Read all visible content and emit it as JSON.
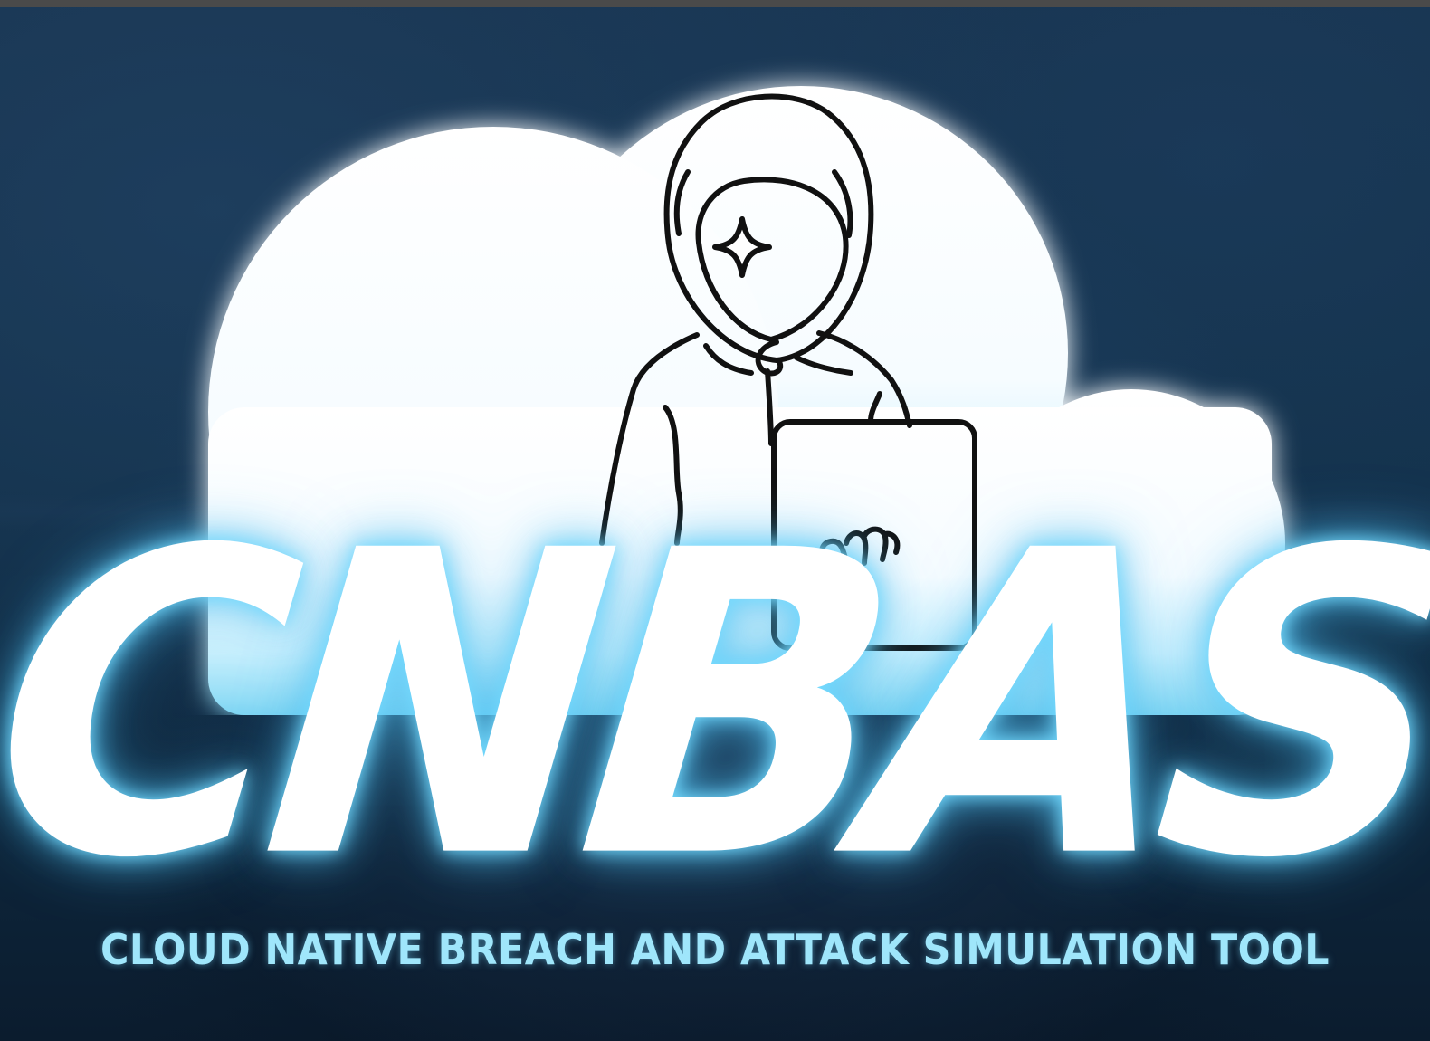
{
  "logo": {
    "wordmark": "CNBAS",
    "tagline": "CLOUD NATIVE BREACH AND ATTACK SIMULATION TOOL",
    "figure_icon": "hooded-hacker-with-laptop-icon"
  },
  "colors": {
    "background": "#123049",
    "cloud": "#ffffff",
    "glow": "#7fdcff",
    "tagline": "#9fe6fb",
    "outline": "#111111"
  }
}
